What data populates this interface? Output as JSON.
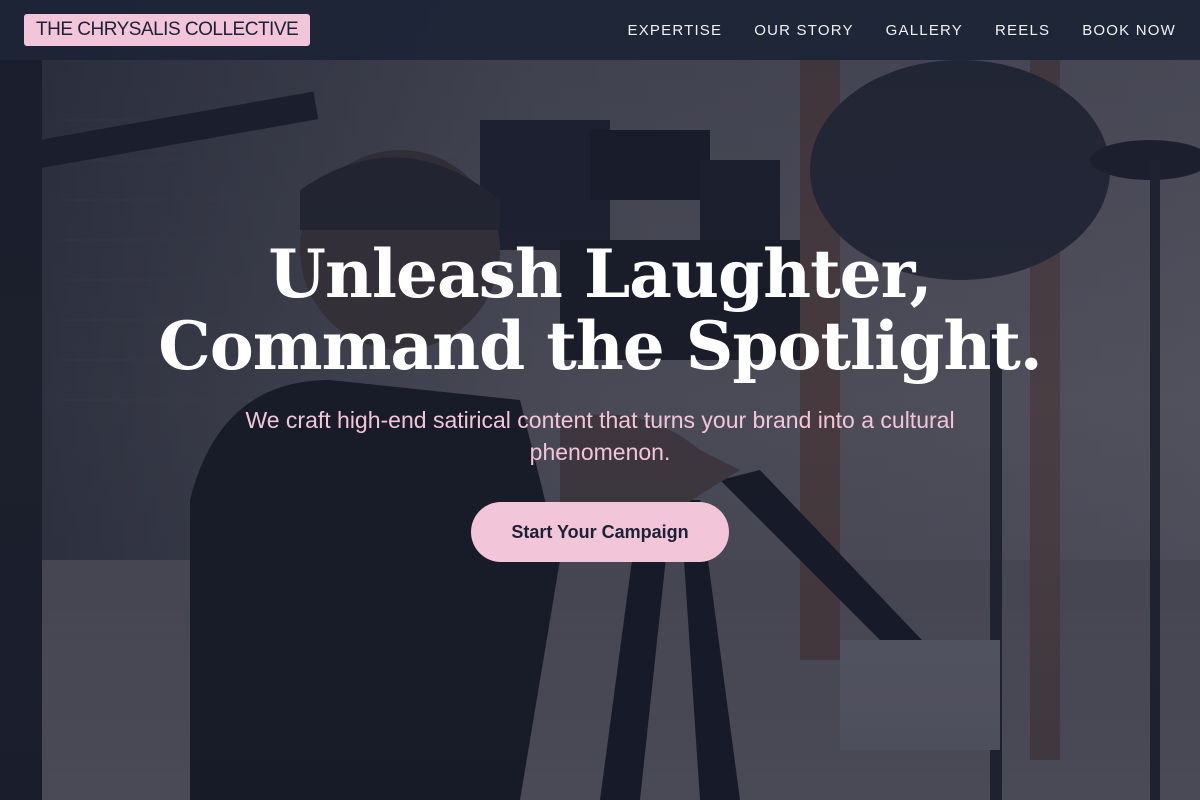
{
  "brand": {
    "name": "THE CHRYSALIS COLLECTIVE",
    "accent": "#f2c5d8",
    "dark": "#1c2236"
  },
  "nav": {
    "items": [
      {
        "label": "EXPERTISE"
      },
      {
        "label": "OUR STORY"
      },
      {
        "label": "GALLERY"
      },
      {
        "label": "REELS"
      },
      {
        "label": "BOOK NOW"
      }
    ]
  },
  "hero": {
    "headline_line1": "Unleash Laughter,",
    "headline_line2": "Command the Spotlight.",
    "subtext": "We craft high-end satirical content that turns your brand into a cultural phenomenon.",
    "cta_label": "Start Your Campaign",
    "background_description_icon": "camera-operator-photo"
  }
}
